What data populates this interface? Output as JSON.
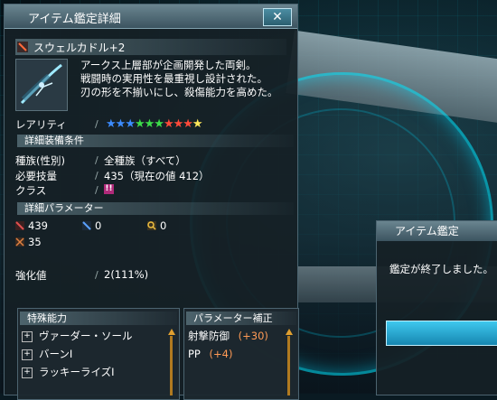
{
  "window": {
    "title": "アイテム鑑定詳細",
    "close_label": "✕"
  },
  "item": {
    "name": "スウェルカドル+2",
    "description": [
      "アークス上層部が企画開発した両剣。",
      "戦闘時の実用性を最重視し設計された。",
      "刃の形を不揃いにし、殺傷能力を高めた。"
    ]
  },
  "rarity": {
    "label": "レアリティ",
    "separator": "/",
    "star_count": 10,
    "star_colors": [
      "#3c8cff",
      "#3c8cff",
      "#3c8cff",
      "#3ddc4a",
      "#3ddc4a",
      "#3ddc4a",
      "#ff4a3a",
      "#ff4a3a",
      "#ff4a3a",
      "#ffe85a"
    ]
  },
  "requirements": {
    "header": "詳細装備条件",
    "race_label": "種族(性別)",
    "race_value": "全種族（すべて）",
    "skill_label": "必要技量",
    "skill_value": "435（現在の値 412）",
    "class_label": "クラス",
    "class_icon": "!!",
    "separator": "/"
  },
  "params": {
    "header": "詳細パラメーター",
    "stats": [
      {
        "icon": "striking-attack-icon",
        "value": "439",
        "color": "#e05050"
      },
      {
        "icon": "ranged-attack-icon",
        "value": "0",
        "color": "#5aa0ff"
      },
      {
        "icon": "technique-attack-icon",
        "value": "0",
        "color": "#f0c040"
      },
      {
        "icon": "dexterity-icon",
        "value": "35",
        "color": "#e08040"
      }
    ]
  },
  "grind": {
    "label": "強化値",
    "separator": "/",
    "value": "2(111%)"
  },
  "special": {
    "header": "特殊能力",
    "abilities": [
      "ヴァーダー・ソール",
      "バーンI",
      "ラッキーライズI"
    ],
    "expand_symbol": "+"
  },
  "bonus": {
    "header": "パラメーター補正",
    "items": [
      {
        "label": "射撃防御",
        "value": "(+30)"
      },
      {
        "label": "PP",
        "value": "(+4)"
      }
    ]
  },
  "dialog": {
    "title": "アイテム鑑定",
    "message": "鑑定が終了しました。"
  }
}
